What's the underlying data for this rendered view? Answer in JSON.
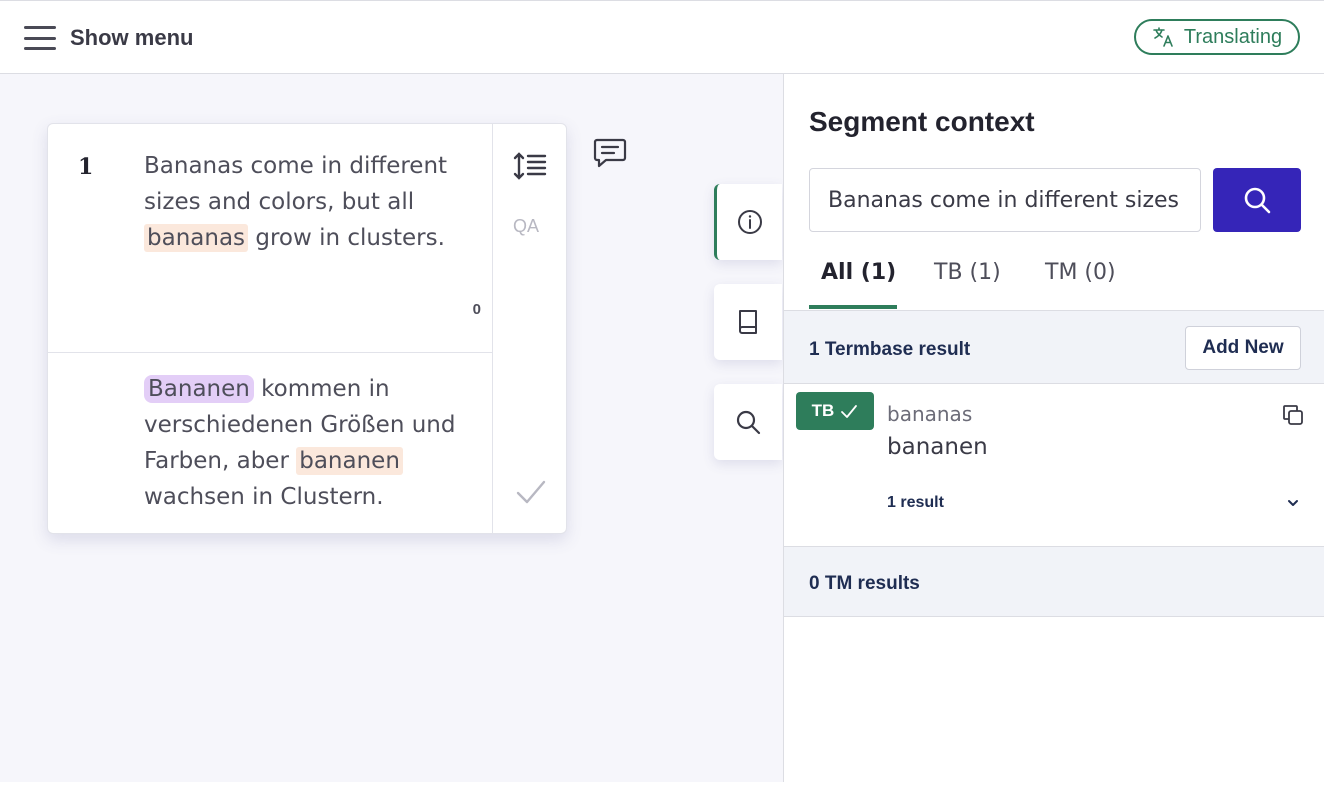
{
  "topbar": {
    "menu_label": "Show menu",
    "status_label": "Translating",
    "status_color": "#2e7d5b"
  },
  "segment": {
    "number": "1",
    "source": {
      "before": "Bananas come in different sizes and colors, but all ",
      "highlight": "bananas",
      "after": " grow in clusters."
    },
    "char_count": "0",
    "target": {
      "highlight_start": "Bananen",
      "middle": " kommen in verschiedenen Größen und Farben, aber ",
      "highlight_term": "bananen",
      "after": " wachsen in Clustern."
    },
    "qa_label": "QA"
  },
  "icons": {
    "menu": "hamburger-icon",
    "status": "translate-icon",
    "line_spacing": "line-spacing-icon",
    "confirm": "check-icon",
    "comment": "comment-icon",
    "info": "info-icon",
    "termbase": "book-icon",
    "search": "search-icon",
    "copy": "copy-icon",
    "expand": "chevron-down-icon"
  },
  "panel": {
    "title": "Segment context",
    "search_value": "Bananas come in different sizes and colors, but all bananas grow in clusters.",
    "tabs": [
      {
        "label": "All (1)",
        "active": true
      },
      {
        "label": "TB (1)",
        "active": false
      },
      {
        "label": "TM (0)",
        "active": false
      }
    ],
    "tb_section": {
      "header": "1 Termbase result",
      "add_new_label": "Add New",
      "result": {
        "badge": "TB",
        "source_term": "bananas",
        "target_term": "bananen",
        "count": "1 result"
      }
    },
    "tm_section": {
      "header": "0 TM results"
    }
  },
  "colors": {
    "accent_green": "#2e7d5b",
    "primary_blue": "#3525b8",
    "highlight_term": "#fbe8dc",
    "highlight_tag": "#e3cef7"
  }
}
